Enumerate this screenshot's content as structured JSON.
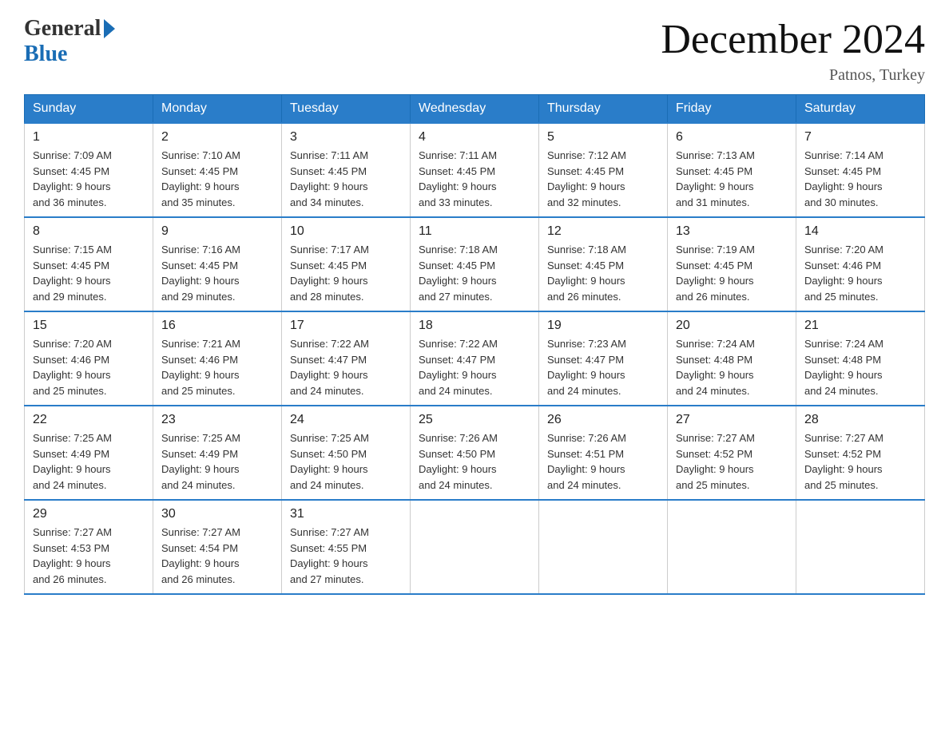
{
  "logo": {
    "general": "General",
    "blue": "Blue"
  },
  "header": {
    "title": "December 2024",
    "location": "Patnos, Turkey"
  },
  "days_of_week": [
    "Sunday",
    "Monday",
    "Tuesday",
    "Wednesday",
    "Thursday",
    "Friday",
    "Saturday"
  ],
  "weeks": [
    [
      {
        "day": "1",
        "sunrise": "7:09 AM",
        "sunset": "4:45 PM",
        "daylight": "9 hours and 36 minutes."
      },
      {
        "day": "2",
        "sunrise": "7:10 AM",
        "sunset": "4:45 PM",
        "daylight": "9 hours and 35 minutes."
      },
      {
        "day": "3",
        "sunrise": "7:11 AM",
        "sunset": "4:45 PM",
        "daylight": "9 hours and 34 minutes."
      },
      {
        "day": "4",
        "sunrise": "7:11 AM",
        "sunset": "4:45 PM",
        "daylight": "9 hours and 33 minutes."
      },
      {
        "day": "5",
        "sunrise": "7:12 AM",
        "sunset": "4:45 PM",
        "daylight": "9 hours and 32 minutes."
      },
      {
        "day": "6",
        "sunrise": "7:13 AM",
        "sunset": "4:45 PM",
        "daylight": "9 hours and 31 minutes."
      },
      {
        "day": "7",
        "sunrise": "7:14 AM",
        "sunset": "4:45 PM",
        "daylight": "9 hours and 30 minutes."
      }
    ],
    [
      {
        "day": "8",
        "sunrise": "7:15 AM",
        "sunset": "4:45 PM",
        "daylight": "9 hours and 29 minutes."
      },
      {
        "day": "9",
        "sunrise": "7:16 AM",
        "sunset": "4:45 PM",
        "daylight": "9 hours and 29 minutes."
      },
      {
        "day": "10",
        "sunrise": "7:17 AM",
        "sunset": "4:45 PM",
        "daylight": "9 hours and 28 minutes."
      },
      {
        "day": "11",
        "sunrise": "7:18 AM",
        "sunset": "4:45 PM",
        "daylight": "9 hours and 27 minutes."
      },
      {
        "day": "12",
        "sunrise": "7:18 AM",
        "sunset": "4:45 PM",
        "daylight": "9 hours and 26 minutes."
      },
      {
        "day": "13",
        "sunrise": "7:19 AM",
        "sunset": "4:45 PM",
        "daylight": "9 hours and 26 minutes."
      },
      {
        "day": "14",
        "sunrise": "7:20 AM",
        "sunset": "4:46 PM",
        "daylight": "9 hours and 25 minutes."
      }
    ],
    [
      {
        "day": "15",
        "sunrise": "7:20 AM",
        "sunset": "4:46 PM",
        "daylight": "9 hours and 25 minutes."
      },
      {
        "day": "16",
        "sunrise": "7:21 AM",
        "sunset": "4:46 PM",
        "daylight": "9 hours and 25 minutes."
      },
      {
        "day": "17",
        "sunrise": "7:22 AM",
        "sunset": "4:47 PM",
        "daylight": "9 hours and 24 minutes."
      },
      {
        "day": "18",
        "sunrise": "7:22 AM",
        "sunset": "4:47 PM",
        "daylight": "9 hours and 24 minutes."
      },
      {
        "day": "19",
        "sunrise": "7:23 AM",
        "sunset": "4:47 PM",
        "daylight": "9 hours and 24 minutes."
      },
      {
        "day": "20",
        "sunrise": "7:24 AM",
        "sunset": "4:48 PM",
        "daylight": "9 hours and 24 minutes."
      },
      {
        "day": "21",
        "sunrise": "7:24 AM",
        "sunset": "4:48 PM",
        "daylight": "9 hours and 24 minutes."
      }
    ],
    [
      {
        "day": "22",
        "sunrise": "7:25 AM",
        "sunset": "4:49 PM",
        "daylight": "9 hours and 24 minutes."
      },
      {
        "day": "23",
        "sunrise": "7:25 AM",
        "sunset": "4:49 PM",
        "daylight": "9 hours and 24 minutes."
      },
      {
        "day": "24",
        "sunrise": "7:25 AM",
        "sunset": "4:50 PM",
        "daylight": "9 hours and 24 minutes."
      },
      {
        "day": "25",
        "sunrise": "7:26 AM",
        "sunset": "4:50 PM",
        "daylight": "9 hours and 24 minutes."
      },
      {
        "day": "26",
        "sunrise": "7:26 AM",
        "sunset": "4:51 PM",
        "daylight": "9 hours and 24 minutes."
      },
      {
        "day": "27",
        "sunrise": "7:27 AM",
        "sunset": "4:52 PM",
        "daylight": "9 hours and 25 minutes."
      },
      {
        "day": "28",
        "sunrise": "7:27 AM",
        "sunset": "4:52 PM",
        "daylight": "9 hours and 25 minutes."
      }
    ],
    [
      {
        "day": "29",
        "sunrise": "7:27 AM",
        "sunset": "4:53 PM",
        "daylight": "9 hours and 26 minutes."
      },
      {
        "day": "30",
        "sunrise": "7:27 AM",
        "sunset": "4:54 PM",
        "daylight": "9 hours and 26 minutes."
      },
      {
        "day": "31",
        "sunrise": "7:27 AM",
        "sunset": "4:55 PM",
        "daylight": "9 hours and 27 minutes."
      },
      null,
      null,
      null,
      null
    ]
  ],
  "labels": {
    "sunrise": "Sunrise:",
    "sunset": "Sunset:",
    "daylight": "Daylight:"
  }
}
